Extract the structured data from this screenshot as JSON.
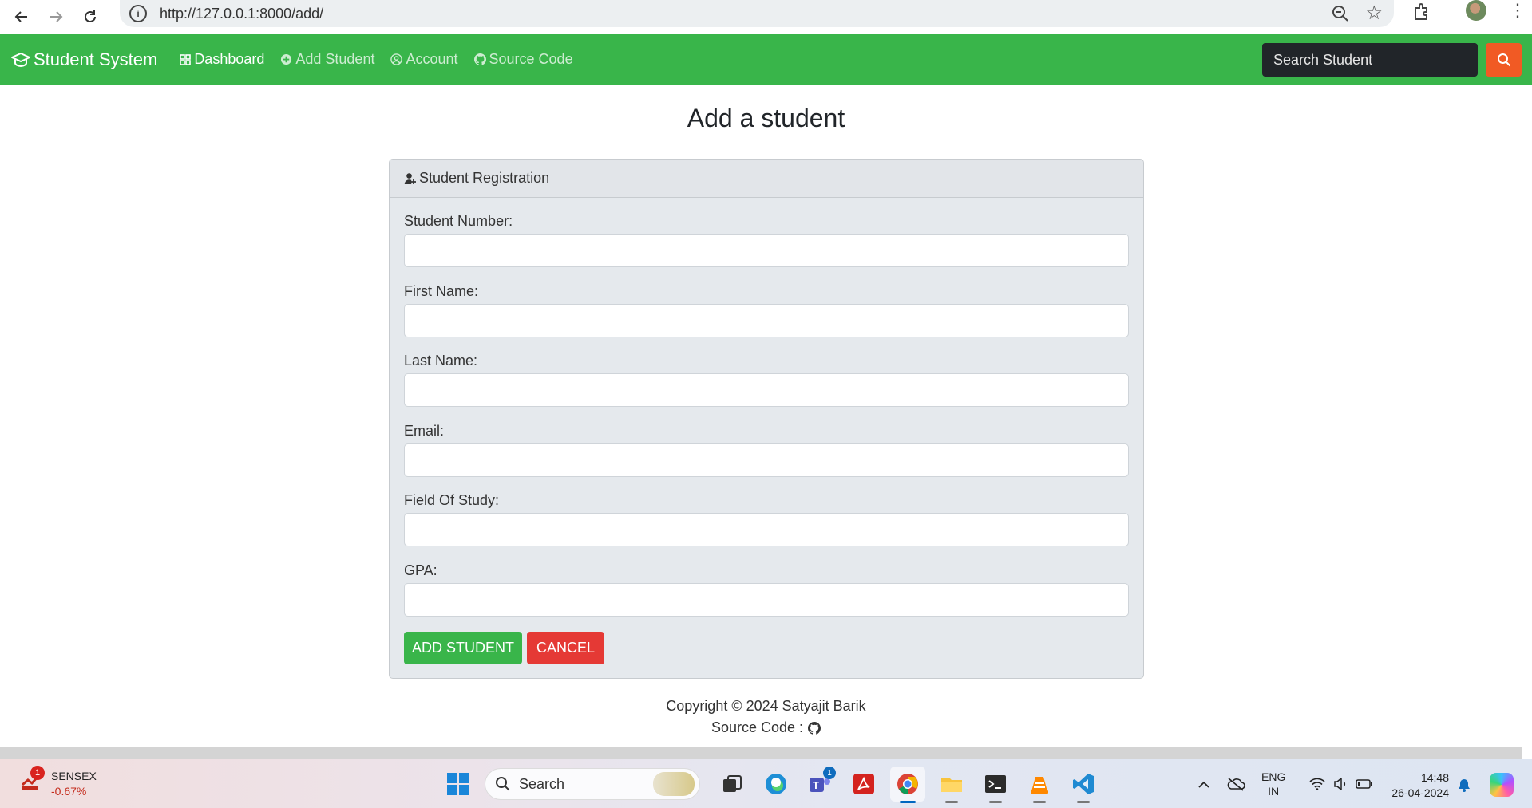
{
  "browser": {
    "url": "http://127.0.0.1:8000/add/"
  },
  "navbar": {
    "brand": "Student System",
    "links": [
      {
        "label": "Dashboard",
        "icon": "grid-icon",
        "active": true
      },
      {
        "label": "Add Student",
        "icon": "plus-circle-icon",
        "active": false
      },
      {
        "label": "Account",
        "icon": "user-circle-icon",
        "active": false
      },
      {
        "label": "Source Code",
        "icon": "github-icon",
        "active": false
      }
    ],
    "search_placeholder": "Search Student"
  },
  "page": {
    "title": "Add a student"
  },
  "form": {
    "header": "Student Registration",
    "fields": [
      {
        "label": "Student Number:",
        "value": ""
      },
      {
        "label": "First Name:",
        "value": ""
      },
      {
        "label": "Last Name:",
        "value": ""
      },
      {
        "label": "Email:",
        "value": ""
      },
      {
        "label": "Field Of Study:",
        "value": ""
      },
      {
        "label": "GPA:",
        "value": ""
      }
    ],
    "submit_label": "ADD STUDENT",
    "cancel_label": "CANCEL"
  },
  "footer": {
    "copyright": "Copyright © 2024 Satyajit Barik",
    "source": "Source Code :"
  },
  "taskbar": {
    "stock_badge": "1",
    "stock_name": "SENSEX",
    "stock_change": "-0.67%",
    "search_label": "Search",
    "teams_badge": "1",
    "lang_top": "ENG",
    "lang_bottom": "IN",
    "time": "14:48",
    "date": "26-04-2024"
  },
  "colors": {
    "navbar": "#39b54a",
    "search_button": "#f15a24",
    "add_button": "#39b54a",
    "cancel_button": "#e53935"
  }
}
